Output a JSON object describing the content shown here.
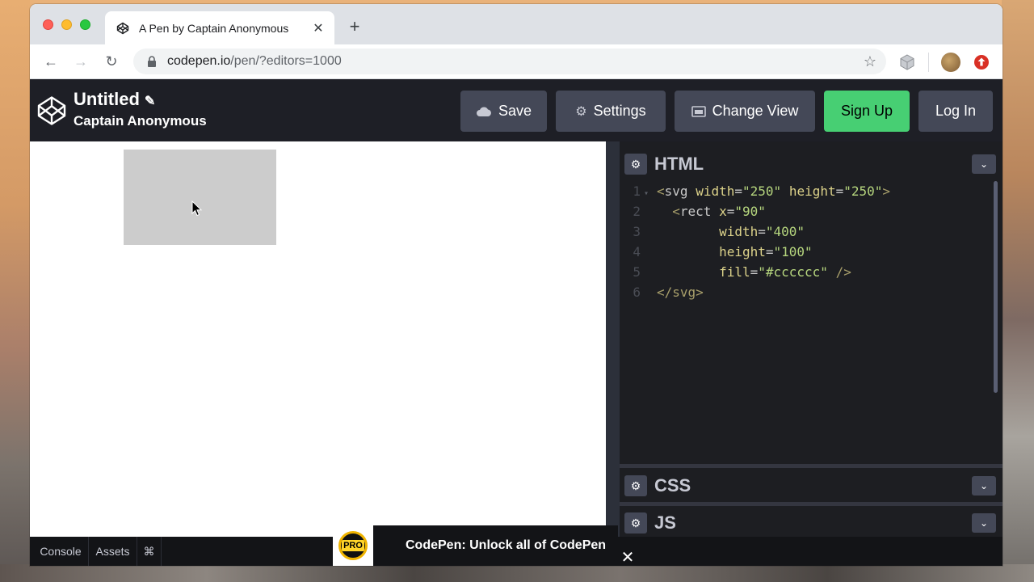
{
  "browser": {
    "tab_title": "A Pen by Captain Anonymous",
    "url_host": "codepen.io",
    "url_path": "/pen/?editors=1000"
  },
  "header": {
    "title": "Untitled",
    "author": "Captain Anonymous",
    "buttons": {
      "save": "Save",
      "settings": "Settings",
      "change_view": "Change View",
      "sign_up": "Sign Up",
      "log_in": "Log In"
    }
  },
  "preview": {
    "rect_fill": "#cccccc"
  },
  "editors": {
    "html_label": "HTML",
    "css_label": "CSS",
    "js_label": "JS",
    "line_numbers": [
      "1",
      "2",
      "3",
      "4",
      "5",
      "6"
    ],
    "code": {
      "l1": {
        "open": "<",
        "tag": "svg",
        "a1": "width",
        "v1": "\"250\"",
        "a2": "height",
        "v2": "\"250\"",
        "close": ">"
      },
      "l2": {
        "open": "<",
        "tag": "rect",
        "a1": "x",
        "v1": "\"90\""
      },
      "l3": {
        "a1": "width",
        "v1": "\"400\""
      },
      "l4": {
        "a1": "height",
        "v1": "\"100\""
      },
      "l5": {
        "a1": "fill",
        "v1": "\"#cccccc\"",
        "close": "/>"
      },
      "l6": {
        "text": "</svg>"
      }
    }
  },
  "bottom_bar": {
    "console": "Console",
    "assets": "Assets",
    "shortcuts": "⌘"
  },
  "promo": {
    "badge": "PRO",
    "text": "CodePen: Unlock all of CodePen"
  },
  "colors": {
    "signup_green": "#47cf73",
    "header_bg": "#1e1f26",
    "button_bg": "#444857"
  }
}
